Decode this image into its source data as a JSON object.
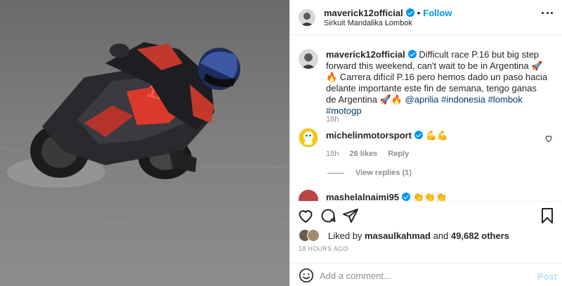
{
  "post": {
    "author": "maverick12official",
    "follow_label": "Follow",
    "separator": "•",
    "location": "Sirkuit Mandalika Lombok",
    "image_number": "12"
  },
  "caption": {
    "username": "maverick12official",
    "text_before_links": "Difficult race P.16 but big step forward this weekend, can't wait to be in Argentina 🚀🔥 Carrera difícil P.16 pero hemos dado un paso hacia delante importante este fin de semana, tengo ganas de Argentina 🚀🔥 ",
    "mention": "@aprilia",
    "hashtags": [
      "#indonesia",
      "#lombok",
      "#motogp"
    ],
    "time": "18h"
  },
  "comments": [
    {
      "username": "michelinmotorsport",
      "text": "💪💪",
      "time": "18h",
      "likes": "26 likes",
      "reply_label": "Reply",
      "view_replies": "View replies (1)"
    },
    {
      "username": "mashelalnaimi95",
      "text": "👏👏👏"
    }
  ],
  "likes": {
    "prefix": "Liked by ",
    "user": "masaulkahmad",
    "middle": " and ",
    "count": "49,682 others"
  },
  "timestamp": "18 HOURS AGO",
  "add_comment": {
    "placeholder": "Add a comment...",
    "post_label": "Post"
  },
  "icons": {
    "like": "heart-icon",
    "comment": "comment-icon",
    "share": "share-icon",
    "save": "bookmark-icon",
    "emoji": "emoji-icon",
    "more": "more-icon"
  },
  "colors": {
    "link": "#00376b",
    "accent": "#0095f6",
    "muted": "#8e8e8e",
    "bike_red": "#d93a2b"
  }
}
